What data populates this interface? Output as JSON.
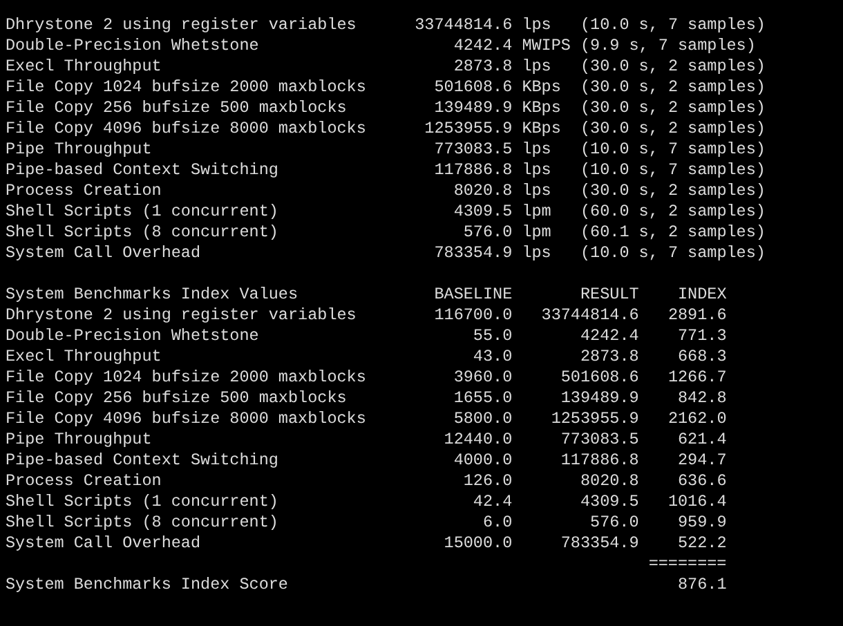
{
  "results": [
    {
      "test": "Dhrystone 2 using register variables",
      "value": "33744814.6",
      "unit": "lps",
      "timing": "(10.0 s, 7 samples)"
    },
    {
      "test": "Double-Precision Whetstone",
      "value": "4242.4",
      "unit": "MWIPS",
      "timing": "(9.9 s, 7 samples)"
    },
    {
      "test": "Execl Throughput",
      "value": "2873.8",
      "unit": "lps",
      "timing": "(30.0 s, 2 samples)"
    },
    {
      "test": "File Copy 1024 bufsize 2000 maxblocks",
      "value": "501608.6",
      "unit": "KBps",
      "timing": "(30.0 s, 2 samples)"
    },
    {
      "test": "File Copy 256 bufsize 500 maxblocks",
      "value": "139489.9",
      "unit": "KBps",
      "timing": "(30.0 s, 2 samples)"
    },
    {
      "test": "File Copy 4096 bufsize 8000 maxblocks",
      "value": "1253955.9",
      "unit": "KBps",
      "timing": "(30.0 s, 2 samples)"
    },
    {
      "test": "Pipe Throughput",
      "value": "773083.5",
      "unit": "lps",
      "timing": "(10.0 s, 7 samples)"
    },
    {
      "test": "Pipe-based Context Switching",
      "value": "117886.8",
      "unit": "lps",
      "timing": "(10.0 s, 7 samples)"
    },
    {
      "test": "Process Creation",
      "value": "8020.8",
      "unit": "lps",
      "timing": "(30.0 s, 2 samples)"
    },
    {
      "test": "Shell Scripts (1 concurrent)",
      "value": "4309.5",
      "unit": "lpm",
      "timing": "(60.0 s, 2 samples)"
    },
    {
      "test": "Shell Scripts (8 concurrent)",
      "value": "576.0",
      "unit": "lpm",
      "timing": "(60.1 s, 2 samples)"
    },
    {
      "test": "System Call Overhead",
      "value": "783354.9",
      "unit": "lps",
      "timing": "(10.0 s, 7 samples)"
    }
  ],
  "index_table": {
    "title": "System Benchmarks Index Values",
    "columns": [
      "BASELINE",
      "RESULT",
      "INDEX"
    ],
    "rows": [
      {
        "test": "Dhrystone 2 using register variables",
        "baseline": "116700.0",
        "result": "33744814.6",
        "index": "2891.6"
      },
      {
        "test": "Double-Precision Whetstone",
        "baseline": "55.0",
        "result": "4242.4",
        "index": "771.3"
      },
      {
        "test": "Execl Throughput",
        "baseline": "43.0",
        "result": "2873.8",
        "index": "668.3"
      },
      {
        "test": "File Copy 1024 bufsize 2000 maxblocks",
        "baseline": "3960.0",
        "result": "501608.6",
        "index": "1266.7"
      },
      {
        "test": "File Copy 256 bufsize 500 maxblocks",
        "baseline": "1655.0",
        "result": "139489.9",
        "index": "842.8"
      },
      {
        "test": "File Copy 4096 bufsize 8000 maxblocks",
        "baseline": "5800.0",
        "result": "1253955.9",
        "index": "2162.0"
      },
      {
        "test": "Pipe Throughput",
        "baseline": "12440.0",
        "result": "773083.5",
        "index": "621.4"
      },
      {
        "test": "Pipe-based Context Switching",
        "baseline": "4000.0",
        "result": "117886.8",
        "index": "294.7"
      },
      {
        "test": "Process Creation",
        "baseline": "126.0",
        "result": "8020.8",
        "index": "636.6"
      },
      {
        "test": "Shell Scripts (1 concurrent)",
        "baseline": "42.4",
        "result": "4309.5",
        "index": "1016.4"
      },
      {
        "test": "Shell Scripts (8 concurrent)",
        "baseline": "6.0",
        "result": "576.0",
        "index": "959.9"
      },
      {
        "test": "System Call Overhead",
        "baseline": "15000.0",
        "result": "783354.9",
        "index": "522.2"
      }
    ]
  },
  "score": {
    "separator": "========",
    "label": "System Benchmarks Index Score",
    "value": "876.1"
  }
}
